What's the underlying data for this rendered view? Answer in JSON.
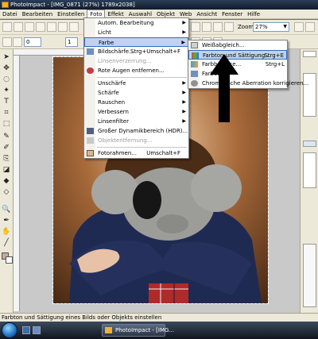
{
  "window": {
    "title": "PhotoImpact - [IMG_0871 (27%) 1789x2038]"
  },
  "menubar": [
    "Datei",
    "Bearbeiten",
    "Einstellen",
    "Foto",
    "Effekt",
    "Auswahl",
    "Objekt",
    "Web",
    "Ansicht",
    "Fenster",
    "Hilfe"
  ],
  "toolbar": {
    "spin1": "0",
    "spin2": "1",
    "zoom_label": "Zoom",
    "zoom_value": "27%"
  },
  "foto_menu": {
    "items": [
      {
        "label": "Autom. Bearbeitung",
        "shortcut": "",
        "submenu": true,
        "disabled": false,
        "icon": ""
      },
      {
        "label": "Licht",
        "shortcut": "",
        "submenu": true,
        "disabled": false,
        "icon": ""
      },
      {
        "label": "Farbe",
        "shortcut": "",
        "submenu": true,
        "disabled": false,
        "icon": "",
        "highlighted": true
      },
      {
        "label": "Bildschärfe...",
        "shortcut": "Strg+Umschalt+F",
        "submenu": false,
        "disabled": false,
        "icon": "sharpen-icon"
      },
      {
        "label": "Linsenverzerrung...",
        "shortcut": "",
        "submenu": false,
        "disabled": true,
        "icon": ""
      },
      {
        "label": "Rote Augen entfernen...",
        "shortcut": "",
        "submenu": false,
        "disabled": false,
        "icon": "red-eye-icon"
      },
      {
        "sep": true
      },
      {
        "label": "Unschärfe",
        "shortcut": "",
        "submenu": true,
        "disabled": false,
        "icon": ""
      },
      {
        "label": "Schärfe",
        "shortcut": "",
        "submenu": true,
        "disabled": false,
        "icon": ""
      },
      {
        "label": "Rauschen",
        "shortcut": "",
        "submenu": true,
        "disabled": false,
        "icon": ""
      },
      {
        "label": "Verbessern",
        "shortcut": "",
        "submenu": true,
        "disabled": false,
        "icon": ""
      },
      {
        "label": "Linsenfilter",
        "shortcut": "",
        "submenu": true,
        "disabled": false,
        "icon": ""
      },
      {
        "label": "Großer Dynamikbereich (HDR)...",
        "shortcut": "",
        "submenu": false,
        "disabled": false,
        "icon": "hdr-icon"
      },
      {
        "label": "Objektentfernung...",
        "shortcut": "",
        "submenu": false,
        "disabled": true,
        "icon": "object-removal-icon"
      },
      {
        "sep": true
      },
      {
        "label": "Fotorahmen...",
        "shortcut": "Umschalt+F",
        "submenu": false,
        "disabled": false,
        "icon": "photo-frame-icon"
      }
    ]
  },
  "farbe_submenu": {
    "items": [
      {
        "label": "Weißabgleich...",
        "shortcut": "",
        "highlighted": false,
        "icon": "white-balance-icon"
      },
      {
        "label": "Farbton und Sättigung...",
        "shortcut": "Strg+E",
        "highlighted": true,
        "icon": "hue-saturation-icon"
      },
      {
        "label": "Farbbalance...",
        "shortcut": "Strg+L",
        "highlighted": false,
        "icon": "color-balance-icon"
      },
      {
        "label": "Farbe...",
        "shortcut": "",
        "highlighted": false,
        "icon": "color-icon"
      },
      {
        "label": "Chromatische Aberration korrigieren...",
        "shortcut": "",
        "highlighted": false,
        "icon": "chromatic-aberration-icon"
      }
    ]
  },
  "statusbar": {
    "text": "Farbton und Sättigung eines Bilds oder Objekts einstellen"
  },
  "taskbar": {
    "tasks": [
      "PhotoImpact - [IMG..."
    ]
  },
  "colors": {
    "menu_highlight": "#c1d2ee",
    "highlight_border": "#316ac5",
    "taskbar": "#1c2533"
  }
}
